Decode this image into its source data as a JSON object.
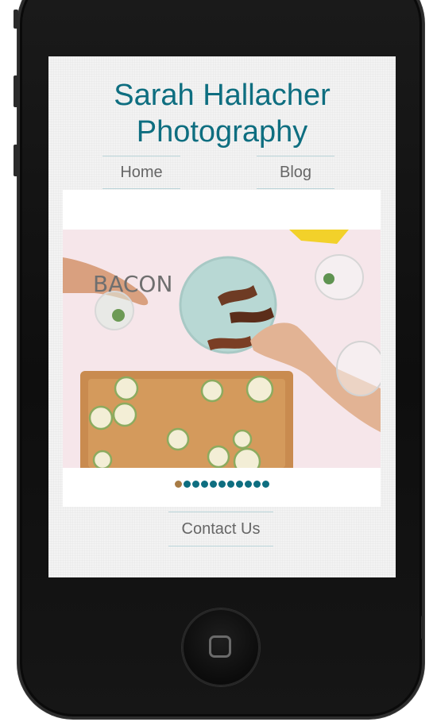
{
  "site": {
    "title": "Sarah Hallacher Photography"
  },
  "nav": {
    "items": [
      {
        "label": "Home"
      },
      {
        "label": "Blog"
      }
    ]
  },
  "slider": {
    "caption": "BACON",
    "slide_count": 11,
    "active_slide": 1
  },
  "footer": {
    "contact_label": "Contact Us"
  },
  "colors": {
    "accent": "#0e6e80",
    "active_dot": "#a77b45",
    "nav_text": "#666666"
  }
}
